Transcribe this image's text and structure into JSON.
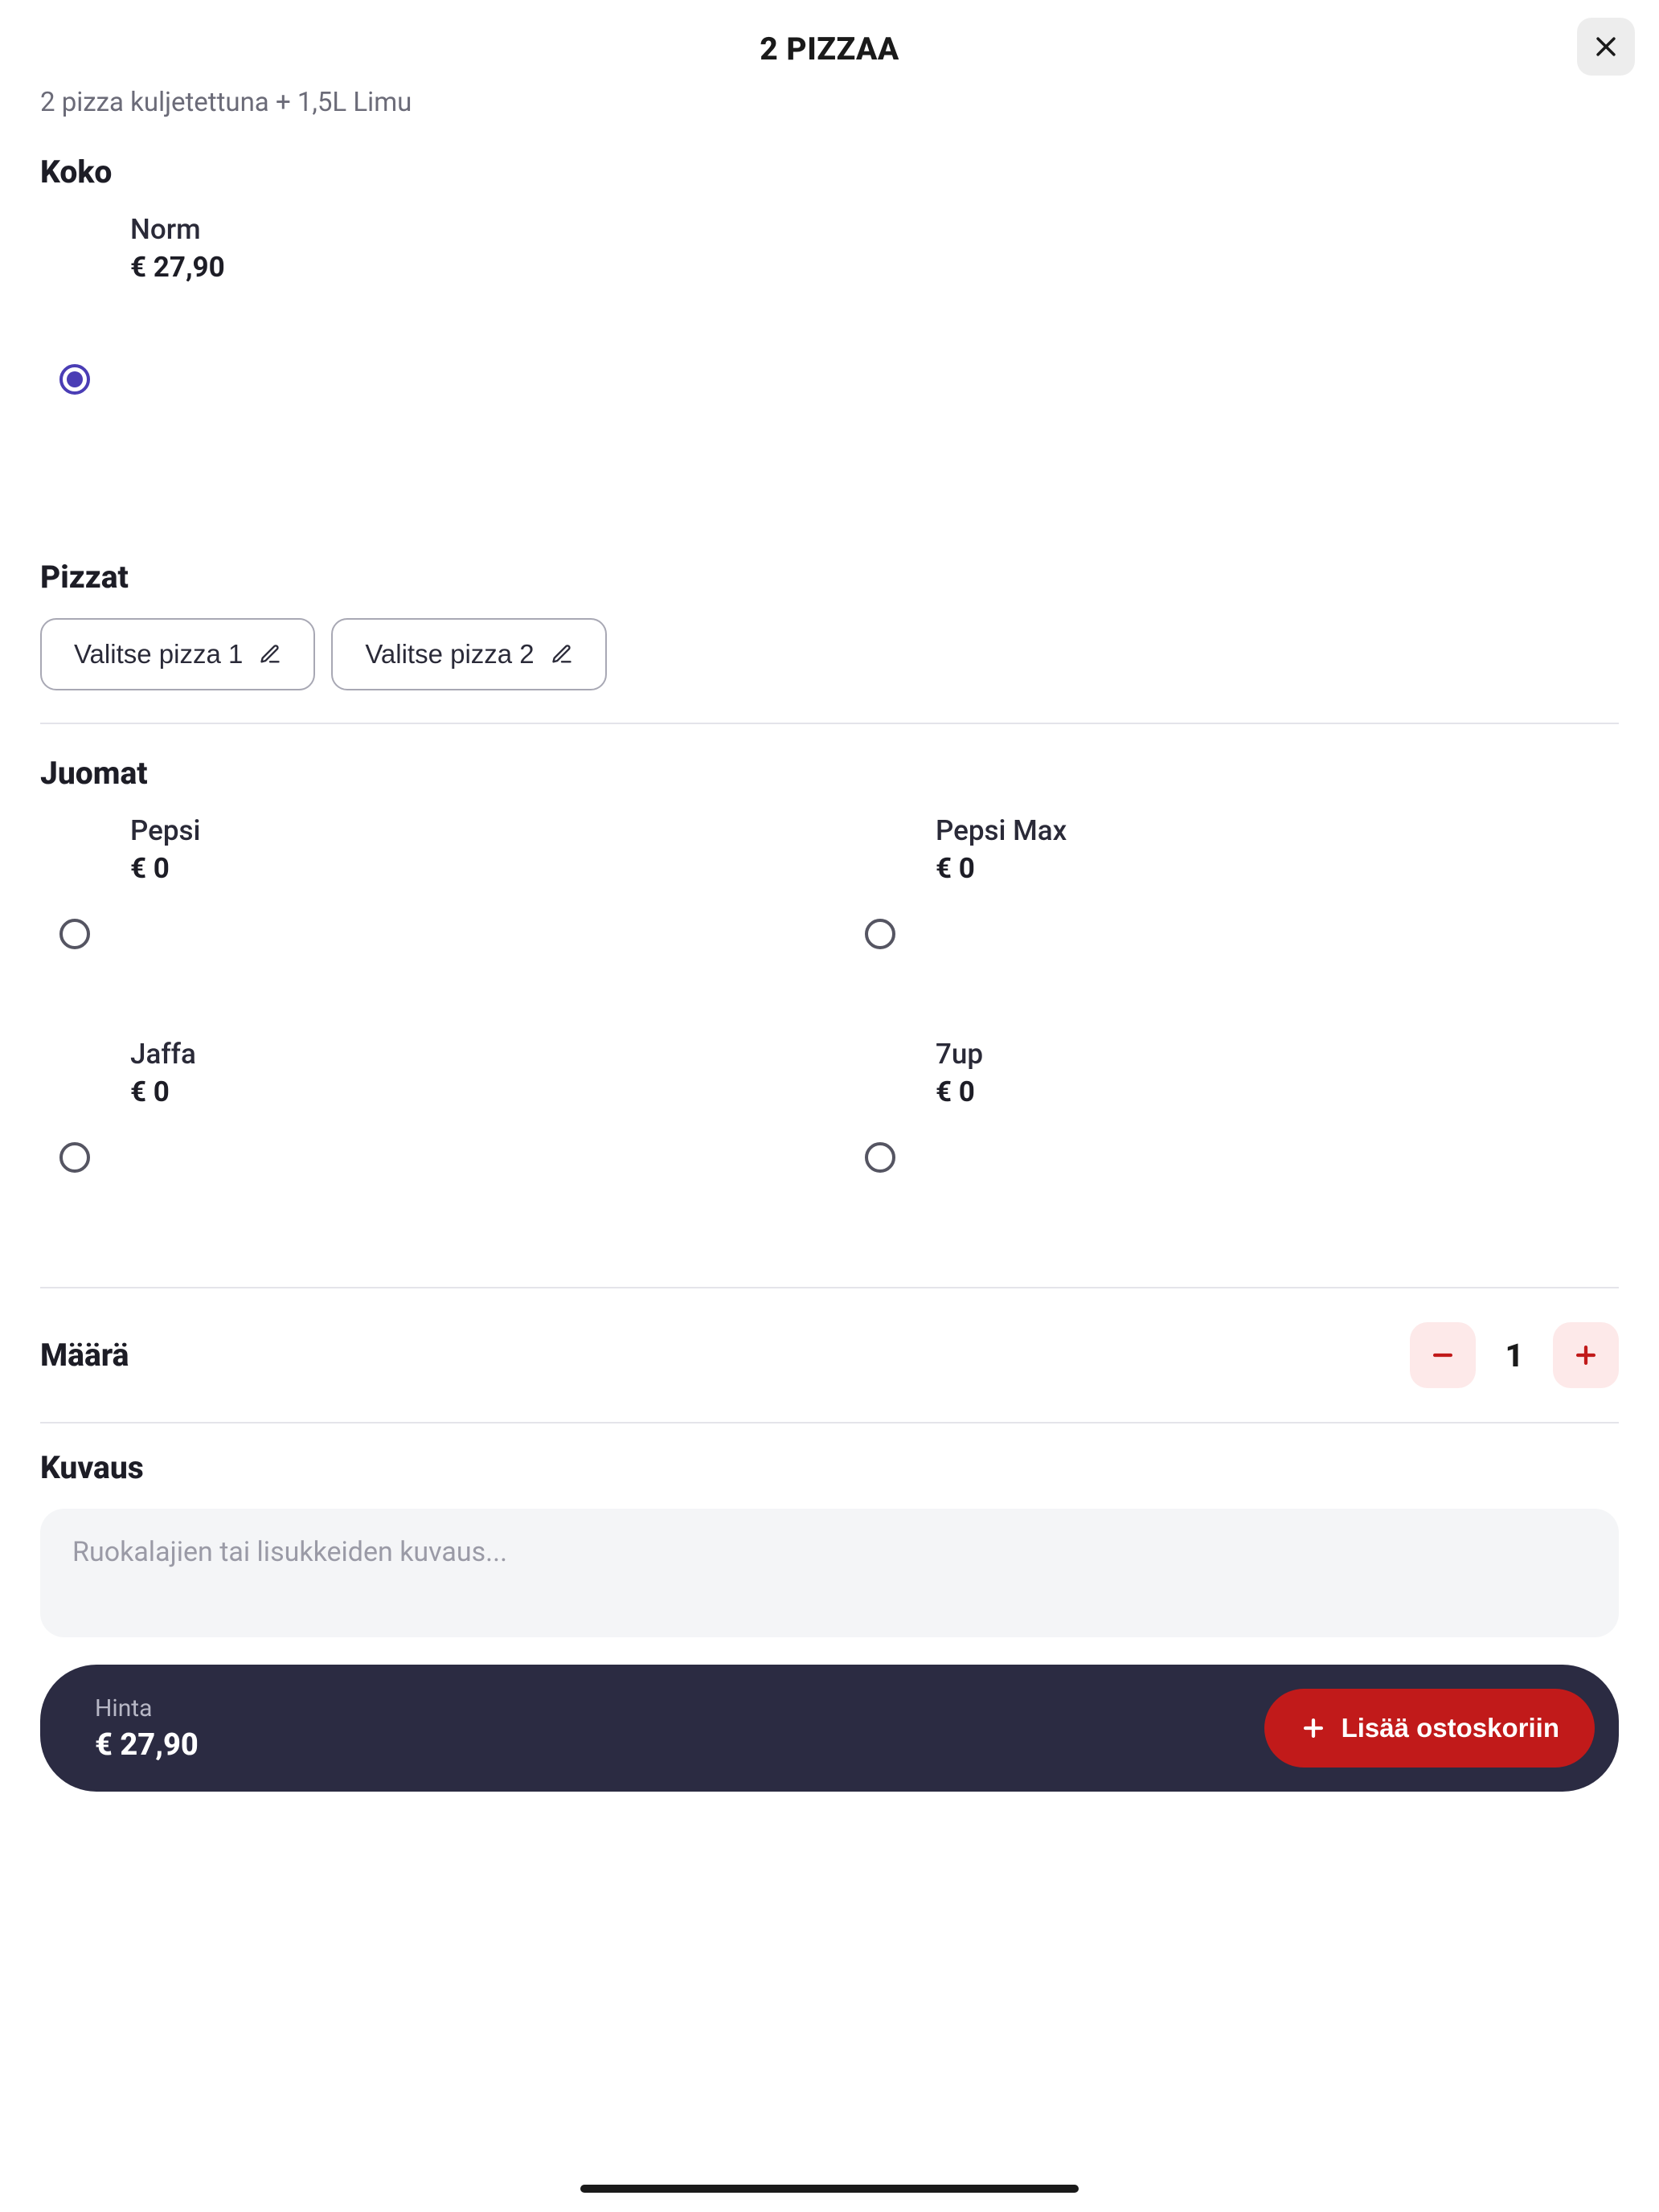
{
  "header": {
    "title": "2 PIZZAA"
  },
  "subtitle": "2 pizza kuljetettuna + 1,5L Limu",
  "size": {
    "heading": "Koko",
    "option_name": "Norm",
    "option_price": "€ 27,90"
  },
  "pizzas": {
    "heading": "Pizzat",
    "btn1": "Valitse pizza 1",
    "btn2": "Valitse pizza 2"
  },
  "drinks": {
    "heading": "Juomat",
    "items": [
      {
        "name": "Pepsi",
        "price": "€ 0"
      },
      {
        "name": "Pepsi Max",
        "price": "€ 0"
      },
      {
        "name": "Jaffa",
        "price": "€ 0"
      },
      {
        "name": "7up",
        "price": "€ 0"
      }
    ]
  },
  "quantity": {
    "heading": "Määrä",
    "value": "1"
  },
  "description": {
    "heading": "Kuvaus",
    "placeholder": "Ruokalajien tai lisukkeiden kuvaus..."
  },
  "footer": {
    "price_label": "Hinta",
    "price_value": "€ 27,90",
    "add_label": "Lisää ostoskoriin"
  }
}
